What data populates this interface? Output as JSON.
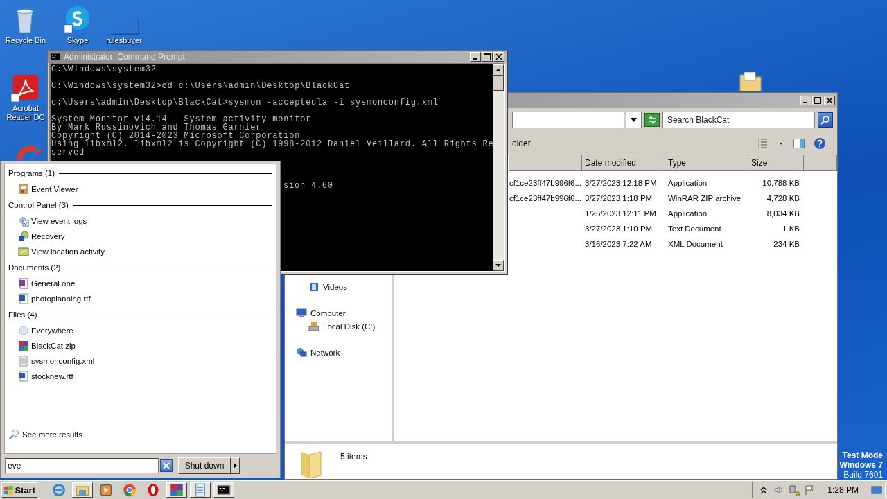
{
  "desktop": {
    "icons": [
      {
        "label": "Recycle Bin",
        "kind": "recycle"
      },
      {
        "label": "Skype",
        "kind": "skype"
      },
      {
        "label": "rulesbuyer",
        "kind": "blank"
      },
      {
        "label": "Acrobat Reader DC",
        "kind": "acrobat"
      }
    ],
    "os_notice": [
      "Test Mode",
      "Windows 7",
      "Build 7601"
    ]
  },
  "command_prompt": {
    "title": "Administrator: Command Prompt",
    "blocks": [
      [
        "C:\\Windows\\system32"
      ],
      [
        "C:\\Windows\\system32>cd c:\\Users\\admin\\Desktop\\BlackCat"
      ],
      [
        "c:\\Users\\admin\\Desktop\\BlackCat>sysmon -accepteula -i sysmonconfig.xml"
      ],
      [
        "System Monitor v14.14 - System activity monitor",
        "By Mark Russinovich and Thomas Garnier",
        "Copyright (C) 2014-2023 Microsoft Corporation",
        "Using libxml2. libxml2 is Copyright (C) 1998-2012 Daniel Veillard. All Rights Re",
        "served"
      ]
    ],
    "partial_line": "sion 4.60"
  },
  "explorer": {
    "toolbar_partial": "older",
    "search": {
      "placeholder": "Search BlackCat"
    },
    "columns": [
      "Date modified",
      "Type",
      "Size"
    ],
    "rows": [
      {
        "name": "cf1ce23ff47b996f6...",
        "date_modified": "3/27/2023 12:18 PM",
        "type": "Application",
        "size": "10,788 KB"
      },
      {
        "name": "cf1ce23ff47b996f6...",
        "date_modified": "3/27/2023 1:18 PM",
        "type": "WinRAR ZIP archive",
        "size": "4,728 KB"
      },
      {
        "date_modified": "1/25/2023 12:11 PM",
        "type": "Application",
        "size": "8,034 KB"
      },
      {
        "date_modified": "3/27/2023 1:10 PM",
        "type": "Text Document",
        "size": "1 KB"
      },
      {
        "date_modified": "3/16/2023 7:22 AM",
        "type": "XML Document",
        "size": "234 KB"
      }
    ],
    "nav": [
      {
        "children": [
          {
            "label": "Videos",
            "kind": "videos"
          }
        ]
      },
      {
        "label": "Computer",
        "kind": "computer",
        "children": [
          {
            "label": "Local Disk (C:)",
            "kind": "disk"
          }
        ]
      },
      {
        "label": "Network",
        "kind": "network"
      }
    ],
    "status": "5 items"
  },
  "start_menu": {
    "groups": [
      {
        "heading": "Programs (1)",
        "items": [
          {
            "label": "Event Viewer",
            "kind": "event-viewer"
          }
        ]
      },
      {
        "heading": "Control Panel (3)",
        "items": [
          {
            "label": "View event logs",
            "kind": "event-logs"
          },
          {
            "label": "Recovery",
            "kind": "recovery"
          },
          {
            "label": "View location activity",
            "kind": "location"
          }
        ]
      },
      {
        "heading": "Documents (2)",
        "items": [
          {
            "label": "General.one",
            "kind": "onenote"
          },
          {
            "label": "photoplanning.rtf",
            "kind": "word"
          }
        ]
      },
      {
        "heading": "Files (4)",
        "items": [
          {
            "label": "Everywhere",
            "kind": "everywhere"
          },
          {
            "label": "BlackCat.zip",
            "kind": "winrar"
          },
          {
            "label": "sysmonconfig.xml",
            "kind": "xml"
          },
          {
            "label": "stocknew.rtf",
            "kind": "word"
          }
        ]
      }
    ],
    "see_more": "See more results",
    "search": {
      "value": "eve"
    },
    "shutdown": "Shut down"
  },
  "taskbar": {
    "start": "Start",
    "apps": [
      {
        "kind": "ie",
        "open": false
      },
      {
        "kind": "explorer",
        "open": true
      },
      {
        "kind": "media",
        "open": false
      },
      {
        "kind": "chrome",
        "open": false
      },
      {
        "kind": "opera",
        "open": false
      },
      {
        "kind": "winrar",
        "open": true
      },
      {
        "kind": "notepad",
        "open": true
      },
      {
        "kind": "cmd",
        "open": true
      }
    ],
    "clock": "1:28 PM"
  }
}
